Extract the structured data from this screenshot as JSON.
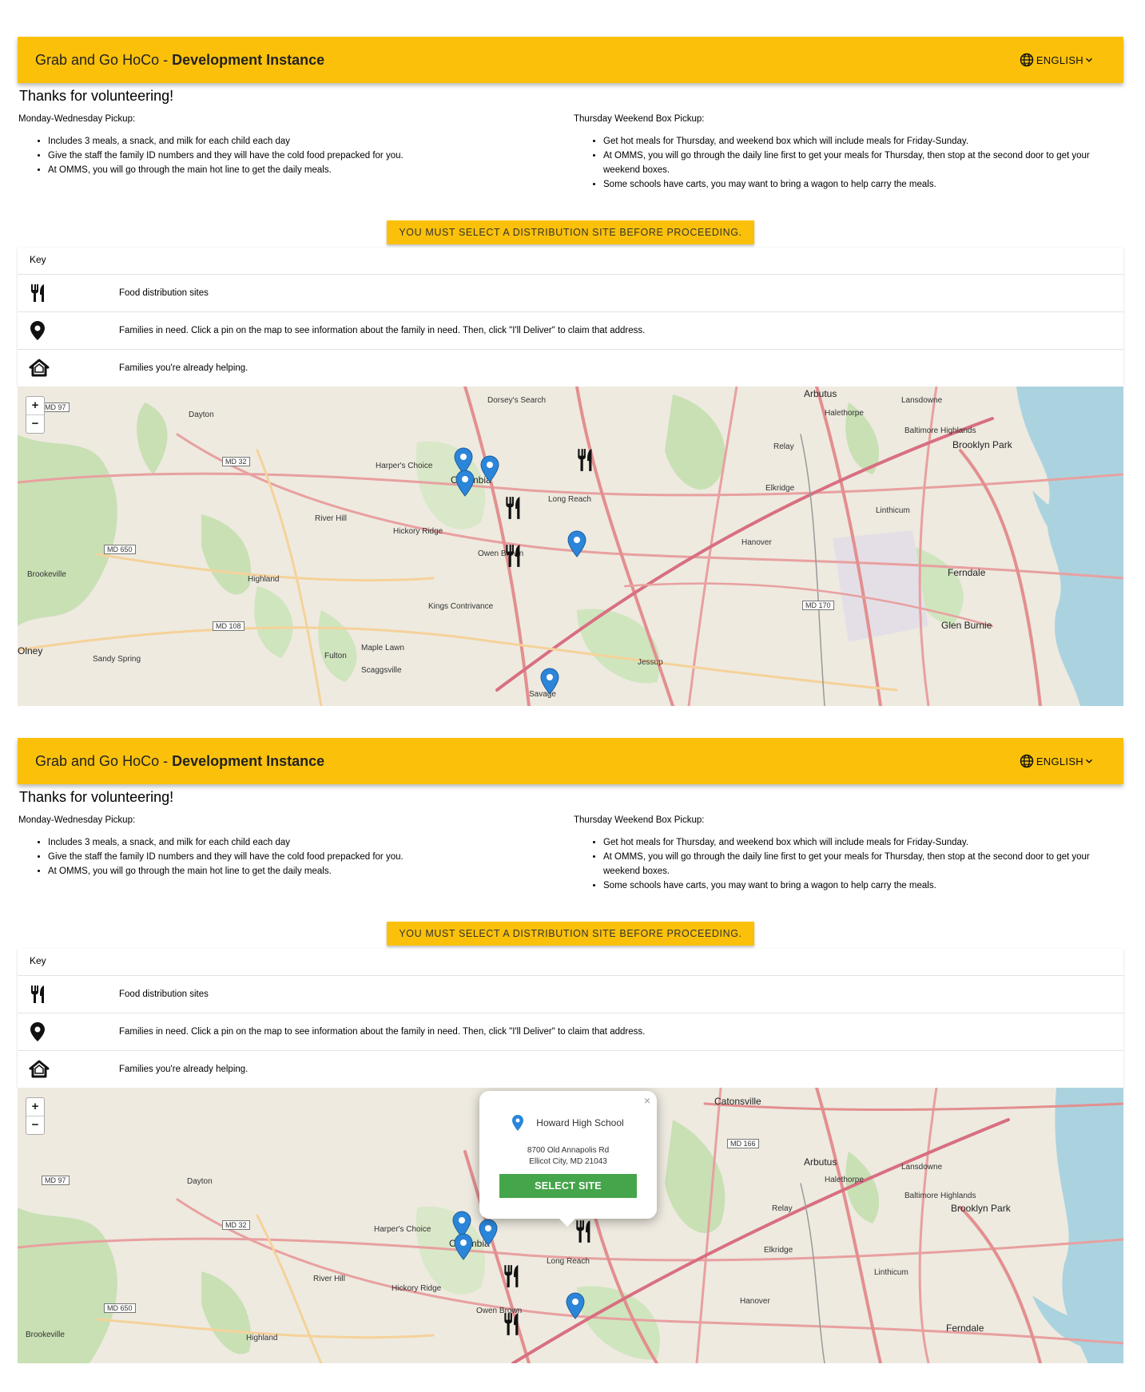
{
  "app": {
    "title_prefix": "Grab and Go HoCo - ",
    "title_strong": "Development Instance",
    "language": "ENGLISH"
  },
  "page": {
    "thanks": "Thanks for volunteering!",
    "monday": {
      "heading": "Monday-Wednesday Pickup:",
      "items": [
        "Includes 3 meals, a snack, and milk for each child each day",
        "Give the staff the family ID numbers and they will have the cold food prepacked for you.",
        "At OMMS, you will go through the main hot line to get the daily meals."
      ]
    },
    "thursday": {
      "heading": "Thursday Weekend Box Pickup:",
      "items": [
        "Get hot meals for Thursday, and weekend box which will include meals for Friday-Sunday.",
        "At OMMS, you will go through the daily line first to get your meals for Thursday, then stop at the second door to get your weekend boxes.",
        "Some schools have carts, you may want to bring a wagon to help carry the meals."
      ]
    },
    "warning": "YOU MUST SELECT A DISTRIBUTION SITE BEFORE PROCEEDING."
  },
  "key": {
    "heading": "Key",
    "rows": [
      {
        "icon": "fork-knife-icon",
        "text": "Food distribution sites"
      },
      {
        "icon": "map-pin-icon",
        "text": "Families in need. Click a pin on the map to see information about the family in need. Then, click \"I'll Deliver\" to claim that address."
      },
      {
        "icon": "home-outline-icon",
        "text": "Families you're already helping."
      }
    ]
  },
  "map": {
    "zoom_in": "+",
    "zoom_out": "−",
    "labels1": [
      "Arbutus",
      "Lansdowne",
      "Halethorpe",
      "Dorsey's Search",
      "Dayton",
      "Baltimore Highlands",
      "Brooklyn Park",
      "Harper's Choice",
      "Columbia",
      "Long Reach",
      "Relay",
      "Elkridge",
      "River Hill",
      "Hickory Ridge",
      "Linthicum",
      "Owen Brown",
      "Hanover",
      "Brookeville",
      "Highland",
      "Ferndale",
      "Kings Contrivance",
      "Glen Burnie",
      "Olney",
      "Sandy Spring",
      "Fulton",
      "Maple Lawn",
      "Scaggsville",
      "Jessup",
      "Savage",
      "MD 97",
      "MD 32",
      "MD 650",
      "MD 108",
      "MD 170"
    ],
    "labels2": [
      "Catonsville",
      "Arbutus",
      "Lansdowne",
      "Halethorpe",
      "Dayton",
      "Baltimore Highlands",
      "Brooklyn Park",
      "Harper's Choice",
      "Columbia",
      "Long Reach",
      "Relay",
      "Elkridge",
      "River Hill",
      "Hickory Ridge",
      "Linthicum",
      "Owen Brown",
      "Hanover",
      "Brookeville",
      "Highland",
      "Ferndale",
      "MD 97",
      "MD 32",
      "MD 650",
      "MD 166"
    ]
  },
  "popup": {
    "title": "Howard High School",
    "address_line1": "8700 Old Annapolis Rd",
    "address_line2": "Ellicot City, MD 21043",
    "button": "SELECT SITE",
    "close": "×"
  },
  "colors": {
    "appbar": "#fbc10a",
    "pin": "#2b86d9",
    "select_button": "#45a54a"
  }
}
